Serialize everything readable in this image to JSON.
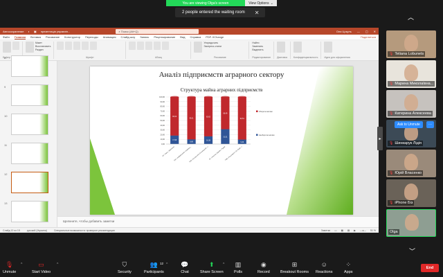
{
  "banner": {
    "viewing": "You are viewing Olga's screen",
    "view_options": "View Options"
  },
  "waiting_room": {
    "message": "2 people entered the waiting room"
  },
  "ppt": {
    "autosave_label": "Автосохранение",
    "file_name": "презентація управлін...",
    "search_placeholder": "Поиск (Alt+Q)",
    "user": "Оля Цокуль",
    "tabs": [
      "Файл",
      "Главная",
      "Вставка",
      "Рисование",
      "Конструктор",
      "Переходы",
      "Анимация",
      "Слайд-шоу",
      "Запись",
      "Рецензирование",
      "Вид",
      "Справка",
      "PDF-XChange"
    ],
    "active_tab": "Главная",
    "share_label": "Поделиться",
    "ribbon_groups": [
      "Буфер обмена",
      "Слайды",
      "Шрифт",
      "Абзац",
      "Рисование",
      "Редактирование",
      "Голос",
      "Конфиденциальность"
    ],
    "ribbon_buttons": {
      "create_slide": "Создать слайд",
      "layout": "Макет",
      "restore": "Восстановить",
      "section": "Раздел",
      "find": "Найти",
      "replace": "Заменить",
      "select": "Выделить",
      "dictate": "Диктовка",
      "ideas": "Идеи для оформления",
      "arrange": "Упорядочить",
      "express_styles": "Экспресс-стили",
      "insert": "Вставить"
    },
    "thumbnails": [
      "8",
      "9",
      "10",
      "11",
      "12",
      "13"
    ],
    "selected_thumbnail": "12",
    "slide": {
      "title": "Аналіз підприємств аграрного сектору",
      "subtitle": "Структура майна аграрних підприємств"
    },
    "notes_placeholder": "Щелкните, чтобы добавить заметки",
    "status": {
      "slide_count": "Слайд 12 из 15",
      "language": "русский (Украина)",
      "accessibility": "Специальные возможности: проверьте рекомендации",
      "notes": "Заметки",
      "zoom": "51 %"
    }
  },
  "chart_data": {
    "type": "bar",
    "stacked": true,
    "categories": [
      "ФГ «Лан», Шевченко",
      "ПАТ «Нибавський» Ізюмвищ...",
      "ТОВ «Агроальянс Сільвіцький...»",
      "ФГ «Агротех Харків», Рудка",
      "ТОВ «Агроінвест» (О. Буде...)"
    ],
    "series": [
      {
        "name": "Необоротні активи",
        "values": [
          17.98,
          9.89,
          16.38,
          31.51,
          9.49
        ],
        "color": "#2f5597"
      },
      {
        "name": "Оборотні активи",
        "values": [
          82.02,
          90.11,
          83.62,
          68.49,
          90.51
        ],
        "color": "#c0282d"
      }
    ],
    "ylim": [
      0,
      100
    ],
    "yticks": [
      "0,00",
      "10,00",
      "20,00",
      "30,00",
      "40,00",
      "50,00",
      "60,00",
      "70,00",
      "80,00",
      "90,00",
      "100,00"
    ],
    "legend_position": "right",
    "grid": true
  },
  "gallery": {
    "participants": [
      {
        "name": "Tetiana Lobunets",
        "muted": true,
        "bg": "#b59a7d"
      },
      {
        "name": "Марина Миколаївна...",
        "muted": true,
        "bg": "#e8e4dc"
      },
      {
        "name": "Катерина Алексеева",
        "muted": true,
        "bg": "#c6c2be"
      },
      {
        "name": "Шинкарук Лідія",
        "muted": true,
        "bg": "#3c4a56"
      },
      {
        "name": "Юрій Власенко",
        "muted": true,
        "bg": "#9a8a7a"
      },
      {
        "name": "iPhone Бiз",
        "muted": true,
        "bg": "#6a6258"
      },
      {
        "name": "Olga",
        "muted": false,
        "bg": "#8e9e92"
      }
    ],
    "ask_to_unmute": "Ask to Unmute",
    "more": "···"
  },
  "toolbar": {
    "unmute": "Unmute",
    "start_video": "Start Video",
    "security": "Security",
    "participants": "Participants",
    "participants_count": "12",
    "chat": "Chat",
    "share_screen": "Share Screen",
    "polls": "Polls",
    "record": "Record",
    "breakout_rooms": "Breakout Rooms",
    "reactions": "Reactions",
    "apps": "Apps",
    "end": "End"
  }
}
